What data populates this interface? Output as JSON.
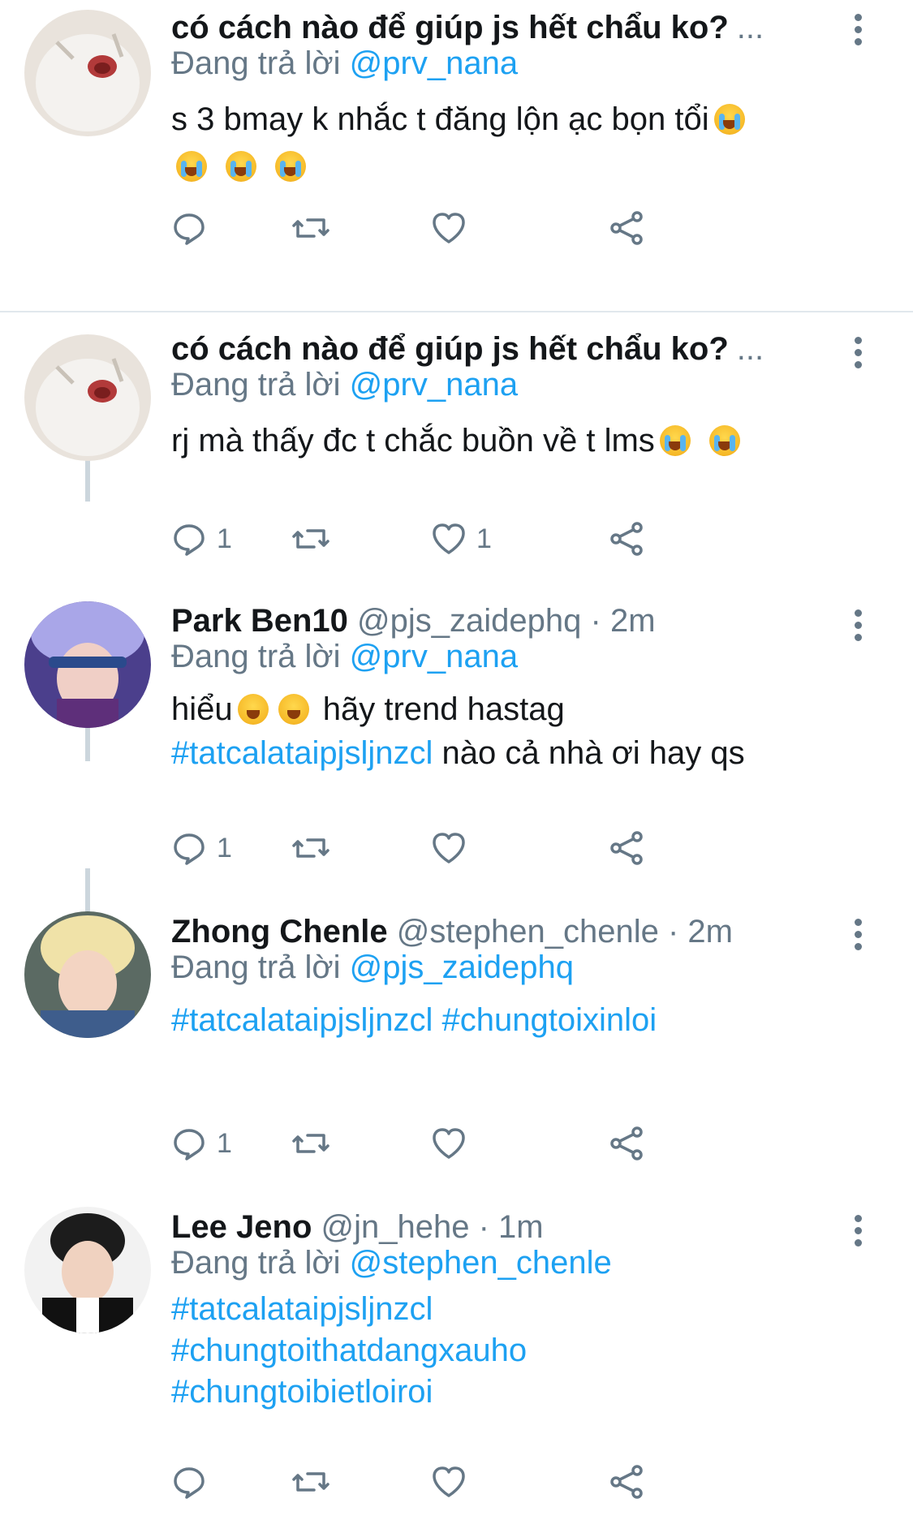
{
  "accent_color": "#1da1f2",
  "muted_color": "#657786",
  "tweets": [
    {
      "title": "có cách nào để giúp js hết chẩu ko?",
      "trunc": "...",
      "reply_prefix": "Đang trả lời",
      "reply_to": "@prv_nana",
      "body_text": "s 3 bmay k nhắc t đăng lộn ạc bọn tổi",
      "reply_count": "",
      "like_count": ""
    },
    {
      "title": "có cách nào để giúp js hết chẩu ko?",
      "trunc": "...",
      "reply_prefix": "Đang trả lời",
      "reply_to": "@prv_nana",
      "body_text": "rj mà thấy đc t chắc buồn về t lms",
      "reply_count": "1",
      "like_count": "1"
    },
    {
      "name": "Park Ben10",
      "handle": "@pjs_zaidephq",
      "time": "· 2m",
      "reply_prefix": "Đang trả lời",
      "reply_to": "@prv_nana",
      "body_text_a": "hiểu",
      "body_text_b": "hãy trend hastag",
      "body_tag": "#tatcalataipjsljnzcl",
      "body_text_c": "nào cả nhà ơi hay qs",
      "reply_count": "1"
    },
    {
      "name": "Zhong Chenle",
      "handle": "@stephen_chenle",
      "time": "· 2m",
      "reply_prefix": "Đang trả lời",
      "reply_to": "@pjs_zaidephq",
      "tag1": "#tatcalataipjsljnzcl",
      "tag2": "#chungtoixinloi",
      "reply_count": "1"
    },
    {
      "name": "Lee Jeno",
      "handle": "@jn_hehe",
      "time": "· 1m",
      "reply_prefix": "Đang trả lời",
      "reply_to": "@stephen_chenle",
      "tag1": "#tatcalataipjsljnzcl",
      "tag2": "#chungtoithatdangxauho",
      "tag3": "#chungtoibietloiroi"
    }
  ]
}
